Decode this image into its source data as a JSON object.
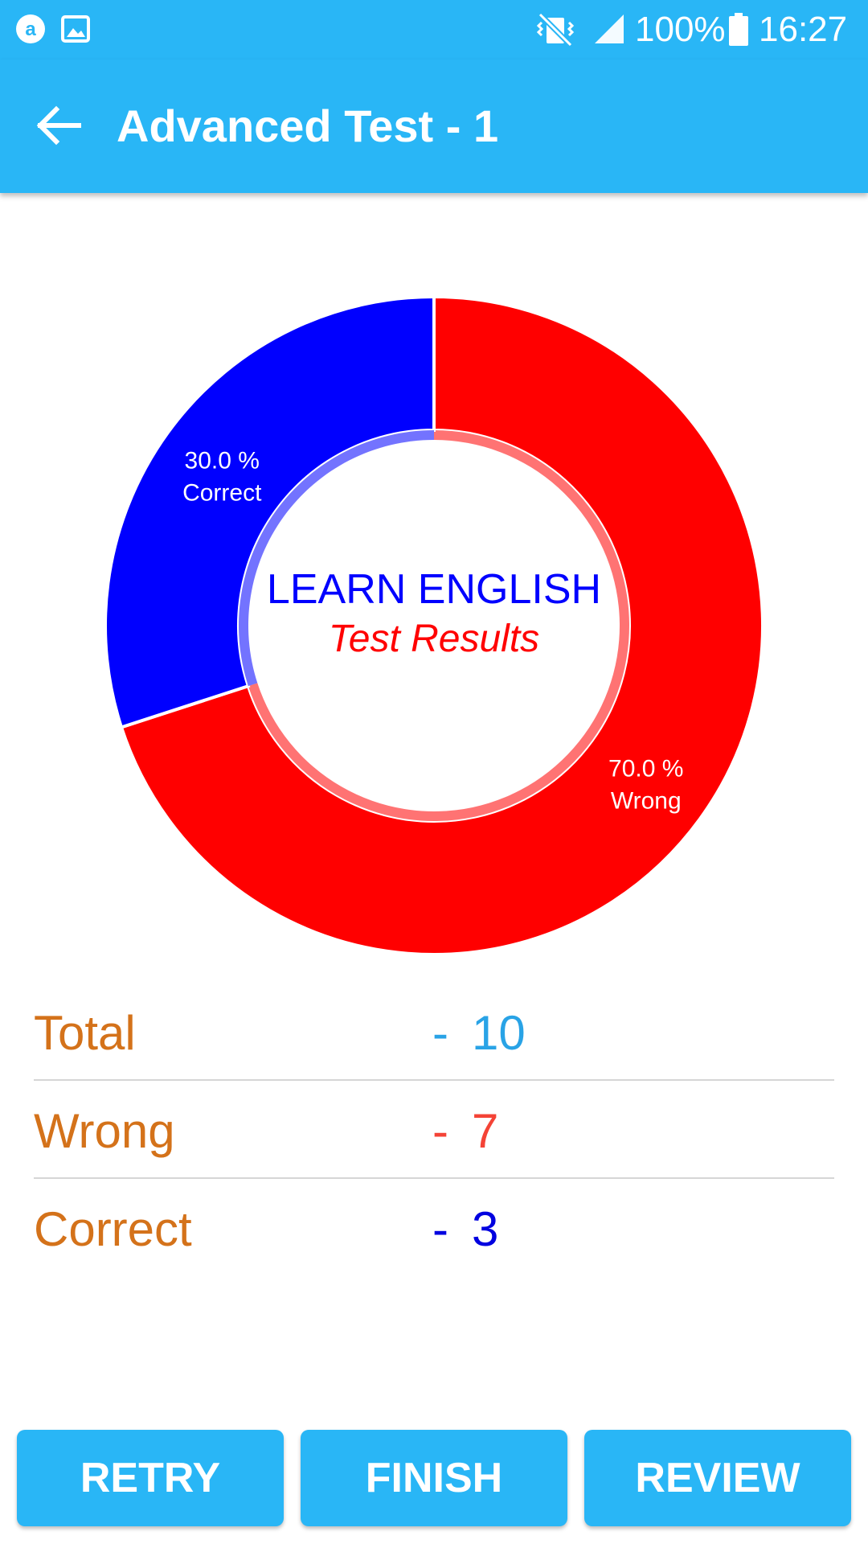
{
  "status_bar": {
    "battery": "100%",
    "time": "16:27",
    "icons": [
      "amazon-app-icon",
      "gallery-icon",
      "vibrate-mute-icon",
      "signal-icon",
      "battery-icon"
    ]
  },
  "app_bar": {
    "title": "Advanced Test - 1",
    "back_icon": "arrow-back-icon"
  },
  "chart_data": {
    "type": "pie",
    "slices": [
      {
        "name": "Correct",
        "value": 30.0,
        "label_value": "30.0 %",
        "label_name": "Correct",
        "color": "#0000ff"
      },
      {
        "name": "Wrong",
        "value": 70.0,
        "label_value": "70.0 %",
        "label_name": "Wrong",
        "color": "#ff0000"
      }
    ],
    "center_title": "LEARN ENGLISH",
    "center_subtitle": "Test Results",
    "center_title_color": "#0000ff",
    "center_subtitle_color": "#ff0000"
  },
  "stats": [
    {
      "label": "Total",
      "dash": "-",
      "value": "10",
      "color": "#29a3e6"
    },
    {
      "label": "Wrong",
      "dash": "-",
      "value": "7",
      "color": "#f44336"
    },
    {
      "label": "Correct",
      "dash": "-",
      "value": "3",
      "color": "#0000e0"
    }
  ],
  "buttons": {
    "retry": "RETRY",
    "finish": "FINISH",
    "review": "REVIEW"
  },
  "colors": {
    "primary": "#29b6f6",
    "stat_label": "#d4721a"
  }
}
